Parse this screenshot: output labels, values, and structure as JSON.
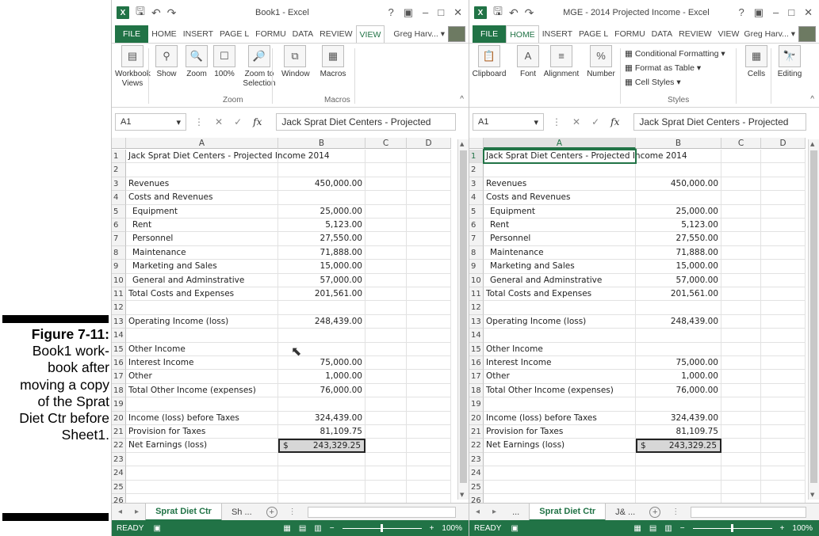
{
  "caption": {
    "label": "Figure 7-11:",
    "text": "Book1 work-book after moving a copy of the Sprat Diet Ctr before Sheet1."
  },
  "left": {
    "title": "Book1 - Excel",
    "menu": [
      "FILE",
      "HOME",
      "INSERT",
      "PAGE L",
      "FORMU",
      "DATA",
      "REVIEW",
      "VIEW"
    ],
    "user": "Greg Harv...",
    "ribbon": {
      "items": [
        "Workbook Views",
        "Show",
        "Zoom",
        "100%",
        "Zoom to Selection",
        "Window",
        "Macros"
      ],
      "groups": [
        "Zoom",
        "Macros"
      ]
    },
    "namebox": "A1",
    "formula": "Jack Sprat Diet Centers - Projected",
    "columns": [
      "A",
      "B",
      "C",
      "D"
    ],
    "rows_to": 26,
    "sheets": [
      "Sprat Diet Ctr",
      "Sh ..."
    ],
    "status": "READY",
    "zoom": "100%"
  },
  "right": {
    "title": "MGE - 2014 Projected Income - Excel",
    "menu": [
      "FILE",
      "HOME",
      "INSERT",
      "PAGE L",
      "FORMU",
      "DATA",
      "REVIEW",
      "VIEW"
    ],
    "user": "Greg Harv...",
    "ribbon": {
      "items": [
        "Clipboard",
        "Font",
        "Alignment",
        "Number",
        "Conditional Formatting",
        "Format as Table",
        "Cell Styles",
        "Cells",
        "Editing"
      ],
      "groups": [
        "Styles"
      ]
    },
    "namebox": "A1",
    "formula": "Jack Sprat Diet Centers - Projected",
    "columns": [
      "A",
      "B",
      "C",
      "D"
    ],
    "rows_to": 26,
    "sheets": [
      "...",
      "Sprat Diet Ctr",
      "J& ..."
    ],
    "status": "READY",
    "zoom": "100%"
  },
  "sheet": {
    "rows": [
      {
        "r": 1,
        "a": "Jack Sprat Diet Centers - Projected Income 2014",
        "b": ""
      },
      {
        "r": 2,
        "a": "",
        "b": ""
      },
      {
        "r": 3,
        "a": "Revenues",
        "b": "450,000.00"
      },
      {
        "r": 4,
        "a": "Costs and Revenues",
        "b": ""
      },
      {
        "r": 5,
        "a": "Equipment",
        "b": "25,000.00",
        "indent": true
      },
      {
        "r": 6,
        "a": "Rent",
        "b": "5,123.00",
        "indent": true
      },
      {
        "r": 7,
        "a": "Personnel",
        "b": "27,550.00",
        "indent": true
      },
      {
        "r": 8,
        "a": "Maintenance",
        "b": "71,888.00",
        "indent": true
      },
      {
        "r": 9,
        "a": "Marketing and Sales",
        "b": "15,000.00",
        "indent": true
      },
      {
        "r": 10,
        "a": "General and Adminstrative",
        "b": "57,000.00",
        "indent": true
      },
      {
        "r": 11,
        "a": "Total Costs and Expenses",
        "b": "201,561.00"
      },
      {
        "r": 12,
        "a": "",
        "b": ""
      },
      {
        "r": 13,
        "a": "Operating Income (loss)",
        "b": "248,439.00"
      },
      {
        "r": 14,
        "a": "",
        "b": ""
      },
      {
        "r": 15,
        "a": "Other Income",
        "b": ""
      },
      {
        "r": 16,
        "a": "Interest Income",
        "b": "75,000.00"
      },
      {
        "r": 17,
        "a": "Other",
        "b": "1,000.00"
      },
      {
        "r": 18,
        "a": "Total Other Income (expenses)",
        "b": "76,000.00"
      },
      {
        "r": 19,
        "a": "",
        "b": ""
      },
      {
        "r": 20,
        "a": "Income (loss) before Taxes",
        "b": "324,439.00"
      },
      {
        "r": 21,
        "a": "Provision for Taxes",
        "b": "81,109.75"
      },
      {
        "r": 22,
        "a": "Net Earnings (loss)",
        "b": "243,329.25",
        "currency": "$"
      }
    ]
  }
}
